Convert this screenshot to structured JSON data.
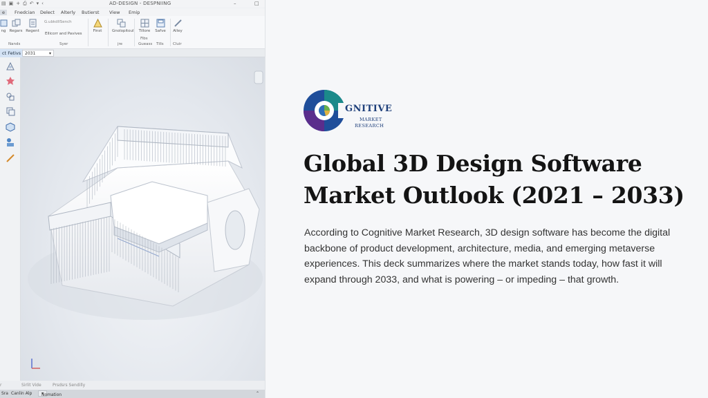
{
  "cad_window": {
    "title": "AD-DESIGN - DESPNIING",
    "menu": [
      "e",
      "Fnedcian",
      "Delect",
      "Alterly",
      "Butierst",
      "View",
      "Emip"
    ],
    "ribbon_tools": [
      "ng",
      "Regars",
      "Regent",
      "Finst",
      "Gnolopitoul",
      "Tillore",
      "Safve",
      "Alley"
    ],
    "ribbon_selector": "G.ubkdllSench",
    "ribbon_subtext": "Fibs",
    "ribbon_group_labels": [
      "Nands",
      "Syer",
      "Gueass",
      "Tills",
      "Cluir"
    ],
    "ribbon_mid_label": "Ellicorr and Pavives",
    "ribbon_mid_sub": "jre",
    "tab_label": "ct Fetivs",
    "tab_year": "2031",
    "status": [
      "Sirlit Vide",
      "Prsdsrs Sendilly"
    ],
    "bottom": [
      "Sra",
      "Canlin Alp",
      "Nomation"
    ]
  },
  "logo": {
    "word": "GNITIVE",
    "sub1": "MARKET",
    "sub2": "RESEARCH",
    "colors": {
      "ring_blue": "#1f4e9a",
      "ring_teal": "#1b8a8a",
      "ring_purple": "#5a2d8c",
      "pie_green": "#6ab04c"
    }
  },
  "slide": {
    "title_line1": "Global 3D Design Software",
    "title_line2": "Market Outlook (2021 – 2033)",
    "body": "According to Cognitive Market Research, 3D design software has become the digital backbone of product development, architecture, media, and emerging metaverse experiences. This deck summarizes where the market stands today, how fast it will expand through 2033, and what is powering – or impeding – that growth."
  }
}
